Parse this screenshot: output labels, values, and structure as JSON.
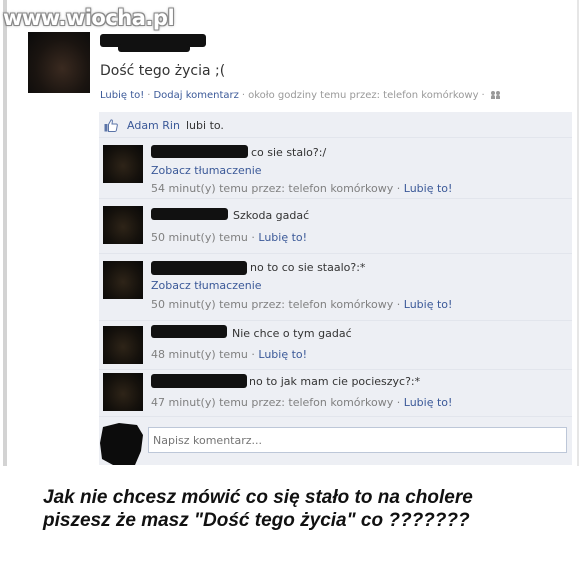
{
  "watermark": "www.wiocha.pl",
  "post": {
    "status": "Dość tego życia ;(",
    "actions": {
      "like": "Lubię to!",
      "comment": "Dodaj komentarz",
      "meta": "około godziny temu przez: telefon komórkowy"
    },
    "likes": {
      "name": "Adam Rin",
      "text": "lubi to."
    }
  },
  "comments": [
    {
      "text": "co sie stalo?:/",
      "translate": "Zobacz tłumaczenie",
      "time": "54 minut(y) temu przez: telefon komórkowy",
      "like": "Lubię to!"
    },
    {
      "text": "Szkoda gadać",
      "translate": "",
      "time": "50 minut(y) temu",
      "like": "Lubię to!"
    },
    {
      "text": "no to co sie staalo?:*",
      "translate": "Zobacz tłumaczenie",
      "time": "50 minut(y) temu przez: telefon komórkowy",
      "like": "Lubię to!"
    },
    {
      "text": "Nie chce o tym gadać",
      "translate": "",
      "time": "48 minut(y) temu",
      "like": "Lubię to!"
    },
    {
      "text": "no to jak mam cie pocieszyc?:*",
      "translate": "",
      "time": "47 minut(y) temu przez: telefon komórkowy",
      "like": "Lubię to!"
    }
  ],
  "write_comment": {
    "placeholder": "Napisz komentarz..."
  },
  "caption": {
    "line1": "Jak nie chcesz mówić co się stało to na cholere",
    "line2": "piszesz że masz \"Dość tego życia\" co ???????"
  },
  "colors": {
    "link": "#3b5998",
    "meta": "#808080",
    "comments_bg": "#edeff4"
  }
}
